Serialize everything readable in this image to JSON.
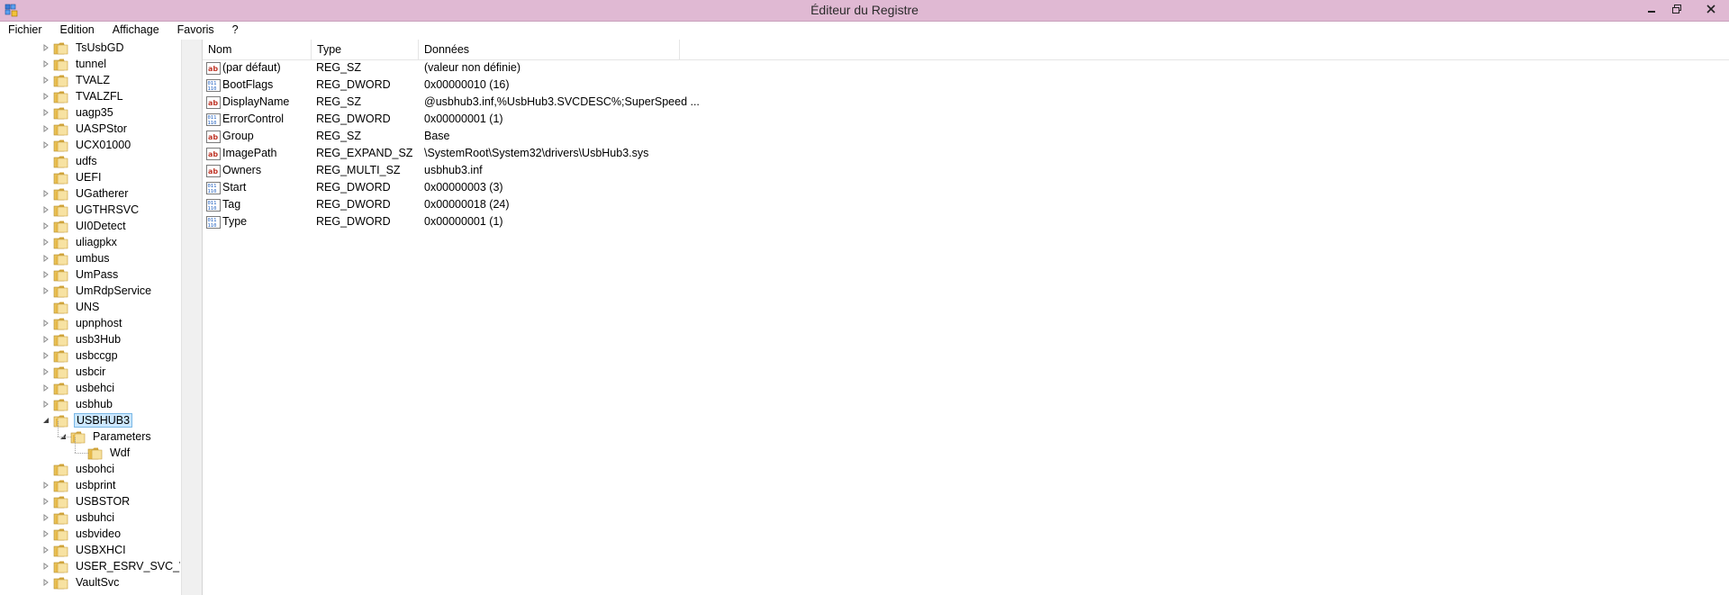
{
  "window": {
    "title": "Éditeur du Registre"
  },
  "menu": [
    "Fichier",
    "Edition",
    "Affichage",
    "Favoris",
    "?"
  ],
  "tree": {
    "items": [
      {
        "label": "TsUsbGD",
        "level": 0,
        "expander": "collapsed"
      },
      {
        "label": "tunnel",
        "level": 0,
        "expander": "collapsed"
      },
      {
        "label": "TVALZ",
        "level": 0,
        "expander": "collapsed"
      },
      {
        "label": "TVALZFL",
        "level": 0,
        "expander": "collapsed"
      },
      {
        "label": "uagp35",
        "level": 0,
        "expander": "collapsed"
      },
      {
        "label": "UASPStor",
        "level": 0,
        "expander": "collapsed"
      },
      {
        "label": "UCX01000",
        "level": 0,
        "expander": "collapsed"
      },
      {
        "label": "udfs",
        "level": 0,
        "expander": "none"
      },
      {
        "label": "UEFI",
        "level": 0,
        "expander": "none"
      },
      {
        "label": "UGatherer",
        "level": 0,
        "expander": "collapsed"
      },
      {
        "label": "UGTHRSVC",
        "level": 0,
        "expander": "collapsed"
      },
      {
        "label": "UI0Detect",
        "level": 0,
        "expander": "collapsed"
      },
      {
        "label": "uliagpkx",
        "level": 0,
        "expander": "collapsed"
      },
      {
        "label": "umbus",
        "level": 0,
        "expander": "collapsed"
      },
      {
        "label": "UmPass",
        "level": 0,
        "expander": "collapsed"
      },
      {
        "label": "UmRdpService",
        "level": 0,
        "expander": "collapsed"
      },
      {
        "label": "UNS",
        "level": 0,
        "expander": "none"
      },
      {
        "label": "upnphost",
        "level": 0,
        "expander": "collapsed"
      },
      {
        "label": "usb3Hub",
        "level": 0,
        "expander": "collapsed"
      },
      {
        "label": "usbccgp",
        "level": 0,
        "expander": "collapsed"
      },
      {
        "label": "usbcir",
        "level": 0,
        "expander": "collapsed"
      },
      {
        "label": "usbehci",
        "level": 0,
        "expander": "collapsed"
      },
      {
        "label": "usbhub",
        "level": 0,
        "expander": "collapsed"
      },
      {
        "label": "USBHUB3",
        "level": 0,
        "expander": "expanded",
        "selected": true
      },
      {
        "label": "Parameters",
        "level": 1,
        "expander": "expanded"
      },
      {
        "label": "Wdf",
        "level": 2,
        "expander": "none"
      },
      {
        "label": "usbohci",
        "level": 0,
        "expander": "none"
      },
      {
        "label": "usbprint",
        "level": 0,
        "expander": "collapsed"
      },
      {
        "label": "USBSTOR",
        "level": 0,
        "expander": "collapsed"
      },
      {
        "label": "usbuhci",
        "level": 0,
        "expander": "collapsed"
      },
      {
        "label": "usbvideo",
        "level": 0,
        "expander": "collapsed"
      },
      {
        "label": "USBXHCI",
        "level": 0,
        "expander": "collapsed"
      },
      {
        "label": "USER_ESRV_SVC_WILLA",
        "level": 0,
        "expander": "collapsed"
      },
      {
        "label": "VaultSvc",
        "level": 0,
        "expander": "collapsed"
      }
    ]
  },
  "list": {
    "columns": [
      "Nom",
      "Type",
      "Données"
    ],
    "rows": [
      {
        "name": "(par défaut)",
        "type": "REG_SZ",
        "data": "(valeur non définie)",
        "icon": "string-value-icon"
      },
      {
        "name": "BootFlags",
        "type": "REG_DWORD",
        "data": "0x00000010 (16)",
        "icon": "binary-value-icon"
      },
      {
        "name": "DisplayName",
        "type": "REG_SZ",
        "data": "@usbhub3.inf,%UsbHub3.SVCDESC%;SuperSpeed ...",
        "icon": "string-value-icon"
      },
      {
        "name": "ErrorControl",
        "type": "REG_DWORD",
        "data": "0x00000001 (1)",
        "icon": "binary-value-icon"
      },
      {
        "name": "Group",
        "type": "REG_SZ",
        "data": "Base",
        "icon": "string-value-icon"
      },
      {
        "name": "ImagePath",
        "type": "REG_EXPAND_SZ",
        "data": "\\SystemRoot\\System32\\drivers\\UsbHub3.sys",
        "icon": "string-value-icon"
      },
      {
        "name": "Owners",
        "type": "REG_MULTI_SZ",
        "data": "usbhub3.inf",
        "icon": "string-value-icon"
      },
      {
        "name": "Start",
        "type": "REG_DWORD",
        "data": "0x00000003 (3)",
        "icon": "binary-value-icon"
      },
      {
        "name": "Tag",
        "type": "REG_DWORD",
        "data": "0x00000018 (24)",
        "icon": "binary-value-icon"
      },
      {
        "name": "Type",
        "type": "REG_DWORD",
        "data": "0x00000001 (1)",
        "icon": "binary-value-icon"
      }
    ]
  },
  "colors": {
    "titlebar": "#e0b9d3",
    "selection": "#cce8ff",
    "folder": "#e8c25a"
  }
}
